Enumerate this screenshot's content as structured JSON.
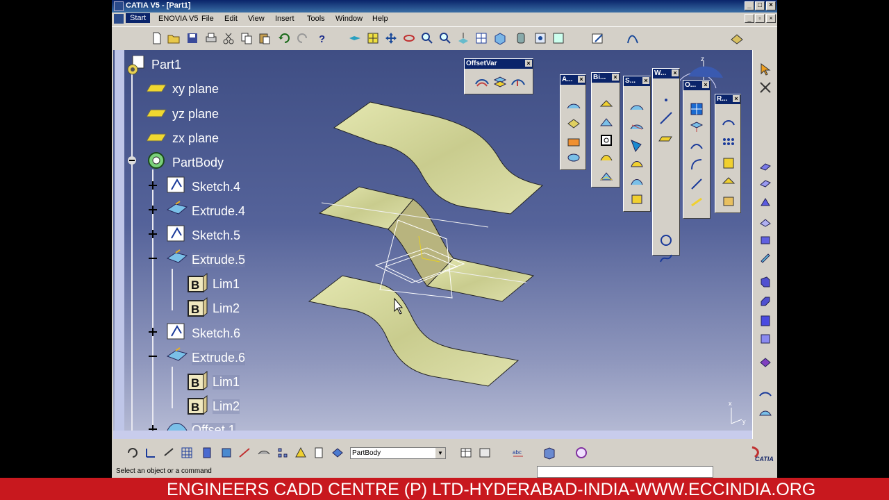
{
  "window": {
    "title": "CATIA V5 - [Part1]"
  },
  "menu": {
    "items": [
      "Start",
      "ENOVIA V5",
      "File",
      "Edit",
      "View",
      "Insert",
      "Tools",
      "Window",
      "Help"
    ]
  },
  "tree": {
    "root": "Part1",
    "planes": [
      "xy plane",
      "yz plane",
      "zx plane"
    ],
    "body": "PartBody",
    "features": [
      "Sketch.4",
      "Extrude.4",
      "Sketch.5",
      "Extrude.5",
      "Lim1",
      "Lim2",
      "Sketch.6",
      "Extrude.6",
      "Lim1",
      "Lim2",
      "Offset.1"
    ]
  },
  "floating_toolbars": {
    "offsetvar": "OffsetVar",
    "a": "A...",
    "bi": "Bi...",
    "s": "S...",
    "w": "W...",
    "o": "O...",
    "r": "R..."
  },
  "compass": {
    "z": "z",
    "x": "x",
    "y": "y"
  },
  "axis": {
    "x": "x",
    "y": "y"
  },
  "bottom": {
    "part_select": "PartBody"
  },
  "status": {
    "text": "Select an object or a command"
  },
  "logo": {
    "text": "CATIA"
  },
  "banner": {
    "text": "ENGINEERS CADD CENTRE (P) LTD-HYDERABAD-INDIA-WWW.ECCINDIA.ORG"
  },
  "colors": {
    "surface": "#d9dca2",
    "viewport_top": "#3f4e84",
    "banner": "#c8181e"
  }
}
